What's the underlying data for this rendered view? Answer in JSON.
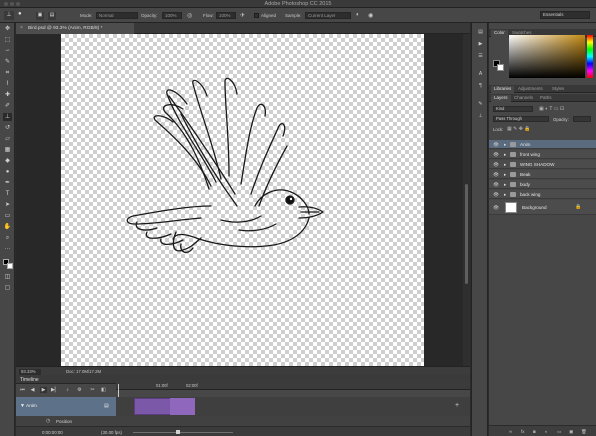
{
  "window": {
    "title": "Adobe Photoshop CC 2015"
  },
  "options_bar": {
    "mode_label": "Mode:",
    "mode_value": "Normal",
    "opacity_label": "Opacity:",
    "opacity_value": "100%",
    "flow_label": "Flow:",
    "flow_value": "100%",
    "aligned_label": "Aligned",
    "sample_label": "Sample:",
    "sample_value": "Current Layer",
    "workspace_value": "Essentials"
  },
  "document": {
    "tab_label": "Bird.psd @ 93.3% (Anim, RGB/8) *",
    "zoom": "93.33%",
    "doc_info": "Doc: 17.0M/17.2M"
  },
  "timeline": {
    "panel_title": "Timeline",
    "ruler_ticks": [
      "01:00f",
      "02:00f"
    ],
    "track_name": "Anim",
    "position_label": "Position",
    "current_time": "0:00:00:00",
    "fps": "(30.00 fps)"
  },
  "color_panel": {
    "tabs": [
      "Color",
      "Swatches"
    ],
    "fg_color": "#000000",
    "bg_color": "#ffffff"
  },
  "libraries_panel": {
    "tabs": [
      "Libraries",
      "Adjustments",
      "Styles"
    ]
  },
  "layers_panel": {
    "tabs": [
      "Layers",
      "Channels",
      "Paths"
    ],
    "filter_kind": "Kind",
    "blend_mode": "Pass Through",
    "opacity_label": "Opacity:",
    "lock_label": "Lock:",
    "layers": [
      {
        "name": "Anim",
        "selected": true
      },
      {
        "name": "front wing",
        "selected": false
      },
      {
        "name": "WING SHADOW",
        "selected": false
      },
      {
        "name": "Beak",
        "selected": false
      },
      {
        "name": "body",
        "selected": false
      },
      {
        "name": "back wing",
        "selected": false
      }
    ],
    "background_layer": "Background"
  }
}
